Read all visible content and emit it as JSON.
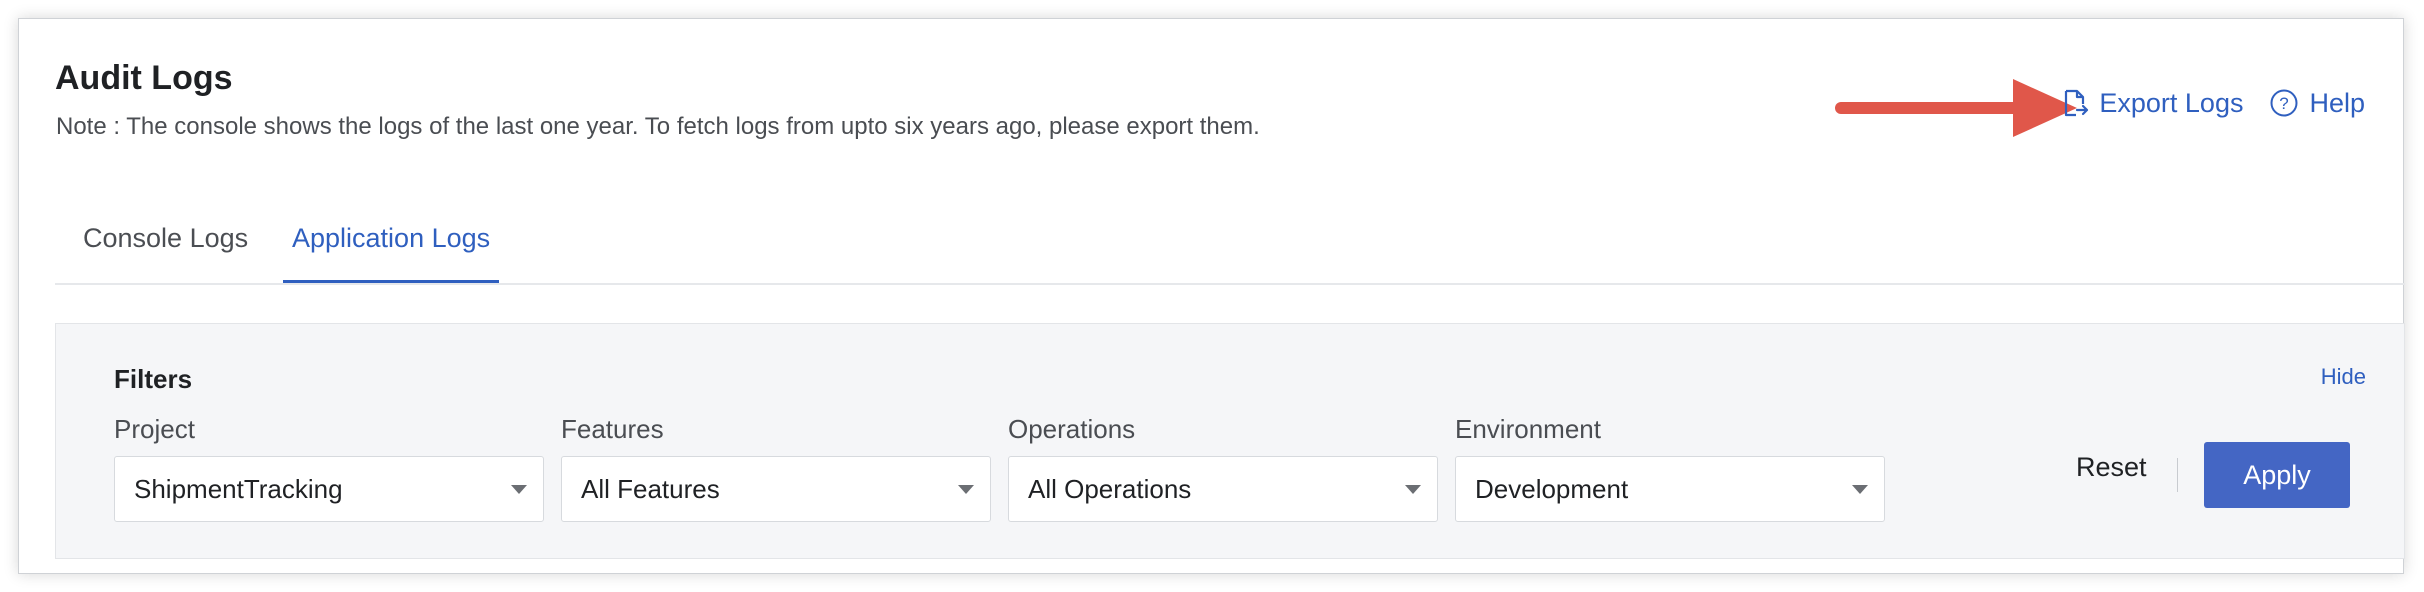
{
  "page": {
    "title": "Audit Logs",
    "note": "Note : The console shows the logs of the last one year. To fetch logs from upto six years ago, please export them."
  },
  "top_actions": {
    "export_label": "Export Logs",
    "export_icon": "file-export-icon",
    "help_label": "Help",
    "help_icon": "help-circle-icon",
    "annotation": "red-arrow-pointing-to-export"
  },
  "tabs": [
    {
      "label": "Console Logs",
      "active": false
    },
    {
      "label": "Application Logs",
      "active": true
    }
  ],
  "filters": {
    "title": "Filters",
    "hide_label": "Hide",
    "fields": [
      {
        "label": "Project",
        "value": "ShipmentTracking"
      },
      {
        "label": "Features",
        "value": "All Features"
      },
      {
        "label": "Operations",
        "value": "All Operations"
      },
      {
        "label": "Environment",
        "value": "Development"
      }
    ],
    "reset_label": "Reset",
    "apply_label": "Apply"
  },
  "colors": {
    "accent": "#2f5fbf",
    "apply_button": "#4466c4",
    "arrow": "#e0574a",
    "panel_bg": "#f5f6f8"
  }
}
